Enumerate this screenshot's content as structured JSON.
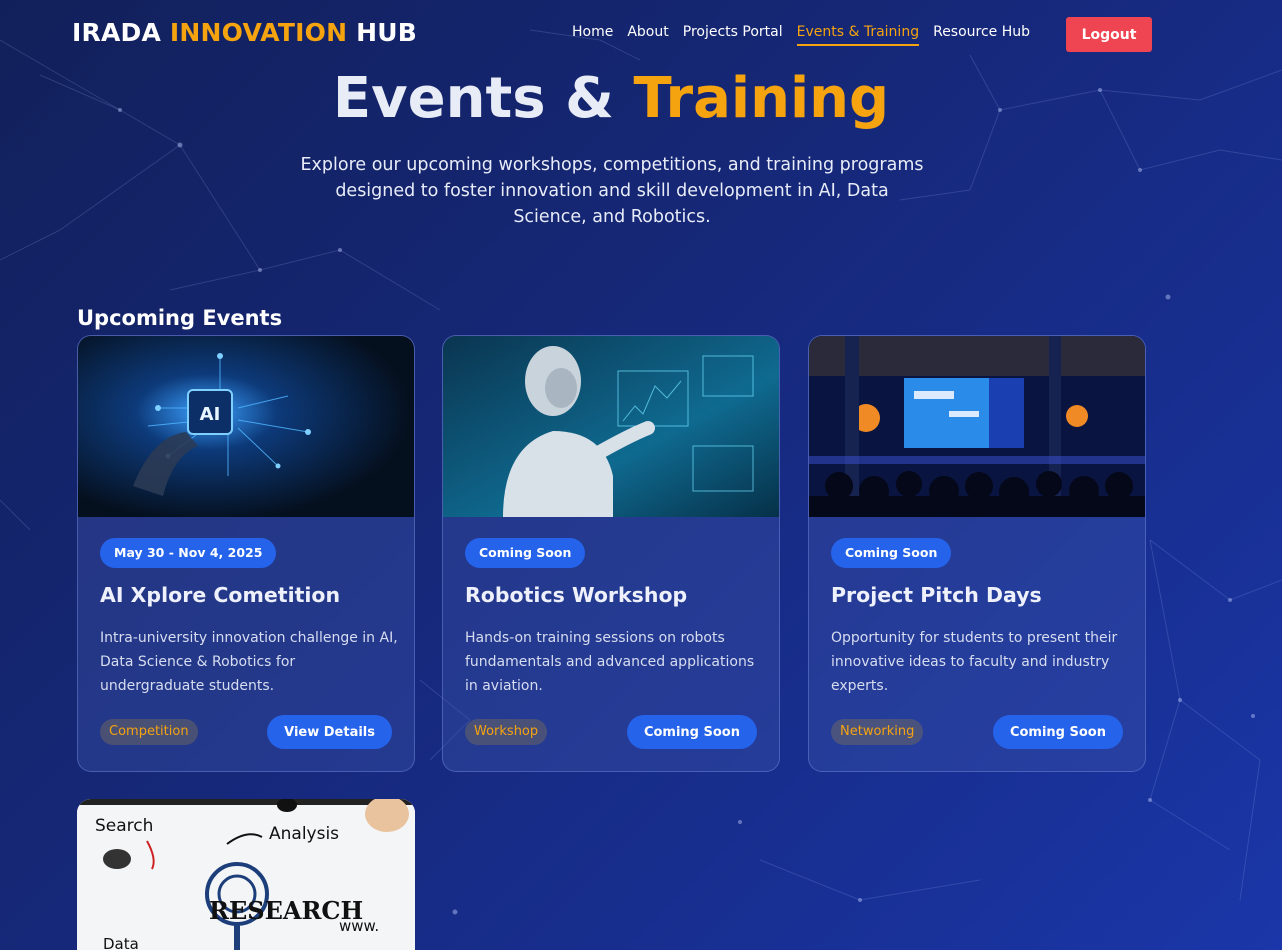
{
  "header": {
    "brand_part1": "IRADA",
    "brand_part2": "INNOVATION",
    "brand_part3": "HUB",
    "nav": [
      "Home",
      "About",
      "Projects Portal",
      "Events & Training",
      "Resource Hub"
    ],
    "active_nav": "Events & Training",
    "logout_label": "Logout"
  },
  "hero": {
    "title_part1": "Events &",
    "title_part2": "Training",
    "subtitle": "Explore our upcoming workshops, competitions, and training programs designed to foster innovation and skill development in AI, Data Science, and Robotics."
  },
  "section_title": "Upcoming Events",
  "events": [
    {
      "image": "ai-chip-image",
      "badge": "May 30 - Nov 4, 2025",
      "title": "AI Xplore Cometition",
      "description": "Intra-university innovation challenge in AI, Data Science & Robotics for undergraduate students.",
      "tag": "Competition",
      "button": "View Details"
    },
    {
      "image": "robot-image",
      "badge": "Coming Soon",
      "title": "Robotics Workshop",
      "description": "Hands-on training sessions on robots fundamentals and advanced applications in aviation.",
      "tag": "Workshop",
      "button": "Coming Soon"
    },
    {
      "image": "conference-stage-image",
      "badge": "Coming Soon",
      "title": "Project Pitch Days",
      "description": "Opportunity for students to present their innovative ideas to faculty and industry experts.",
      "tag": "Networking",
      "button": "Coming Soon"
    },
    {
      "image": "research-sketch-image",
      "sketch_words": [
        "Search",
        "Analysis",
        "RESEARCH",
        "Data",
        "www."
      ]
    }
  ],
  "colors": {
    "accent": "#f5a30f",
    "primary_button": "#2563eb",
    "logout": "#ef4452",
    "background": "#16287a"
  }
}
